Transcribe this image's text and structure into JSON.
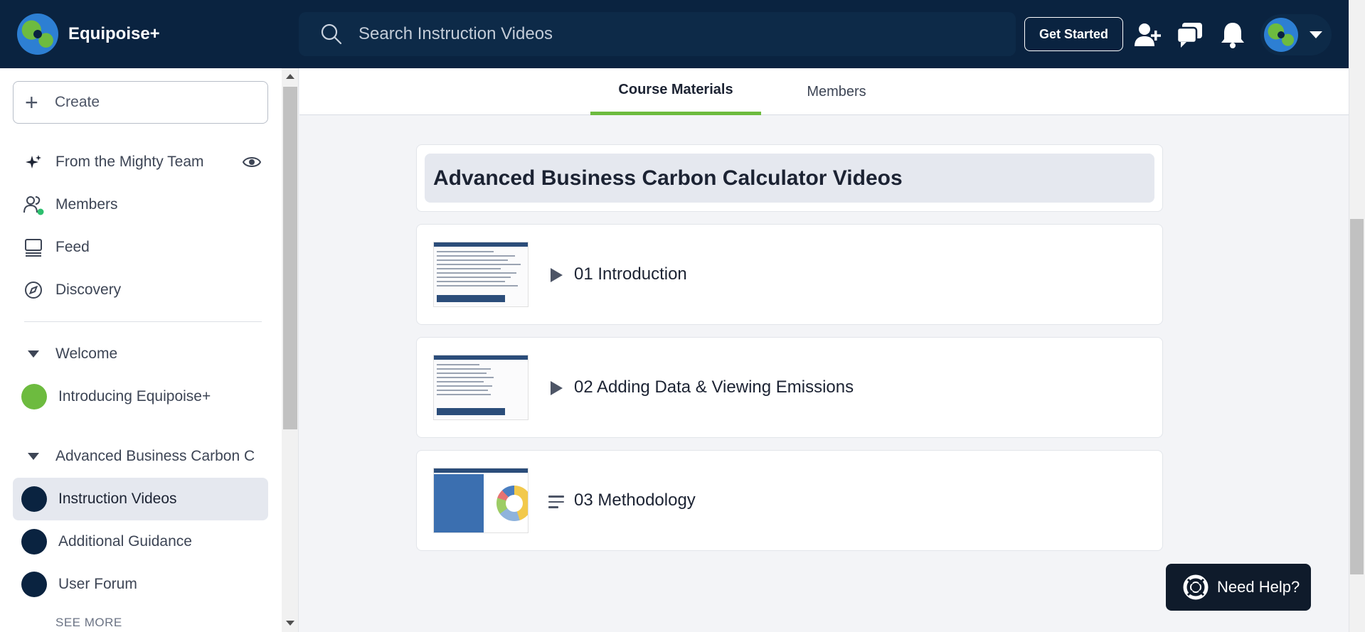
{
  "header": {
    "brand": "Equipoise+",
    "search_placeholder": "Search Instruction Videos",
    "get_started": "Get Started",
    "icons": [
      "add-person-icon",
      "chat-icon",
      "bell-icon",
      "avatar",
      "chevron-down-icon"
    ]
  },
  "sidebar": {
    "create_label": "Create",
    "items": [
      {
        "label": "From the Mighty Team",
        "icon": "sparkle-icon"
      },
      {
        "label": "Members",
        "icon": "members-icon"
      },
      {
        "label": "Feed",
        "icon": "feed-icon"
      },
      {
        "label": "Discovery",
        "icon": "compass-icon"
      }
    ],
    "sections": [
      {
        "label": "Welcome",
        "children": [
          {
            "label": "Introducing Equipoise+",
            "color": "#6dbb3f"
          }
        ]
      },
      {
        "label": "Advanced Business Carbon C",
        "children": [
          {
            "label": "Instruction Videos",
            "color": "#0a2340",
            "active": true
          },
          {
            "label": "Additional Guidance",
            "color": "#0a2340"
          },
          {
            "label": "User Forum",
            "color": "#0a2340"
          }
        ]
      }
    ],
    "see_more": "SEE MORE"
  },
  "tabs": [
    {
      "label": "Course Materials",
      "active": true
    },
    {
      "label": "Members",
      "active": false
    }
  ],
  "course": {
    "title": "Advanced Business Carbon Calculator Videos",
    "lessons": [
      {
        "title": "01 Introduction",
        "type": "video"
      },
      {
        "title": "02 Adding Data & Viewing Emissions",
        "type": "video"
      },
      {
        "title": "03 Methodology",
        "type": "document"
      }
    ]
  },
  "help": {
    "label": "Need Help?"
  },
  "colors": {
    "navy": "#0a2340",
    "accent": "#6dbb3f"
  }
}
